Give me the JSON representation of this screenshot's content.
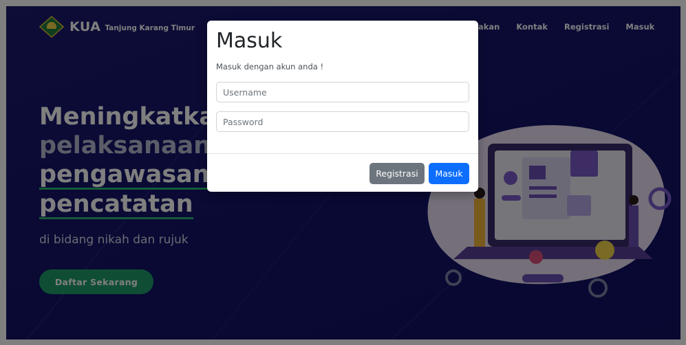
{
  "navbar": {
    "brand": "KUA",
    "brand_subtitle": "Tanjung Karang Timur",
    "links": [
      "jakan",
      "Kontak",
      "Registrasi",
      "Masuk"
    ]
  },
  "hero": {
    "line1": "Meningkatka",
    "line2": "pelaksanaan",
    "line3": "pengawasan",
    "line4": "pencatatan",
    "subtitle": "di bidang nikah dan rujuk",
    "cta": "Daftar Sekarang"
  },
  "modal": {
    "title": "Masuk",
    "subtitle": "Masuk dengan akun anda !",
    "username_placeholder": "Username",
    "password_placeholder": "Password",
    "register_button": "Registrasi",
    "login_button": "Masuk"
  },
  "colors": {
    "background": "#14146a",
    "accent_green": "#1f9d6b",
    "primary_button": "#0d6efd",
    "secondary_button": "#6c757d"
  },
  "icons": [
    "kua-logo-icon"
  ]
}
